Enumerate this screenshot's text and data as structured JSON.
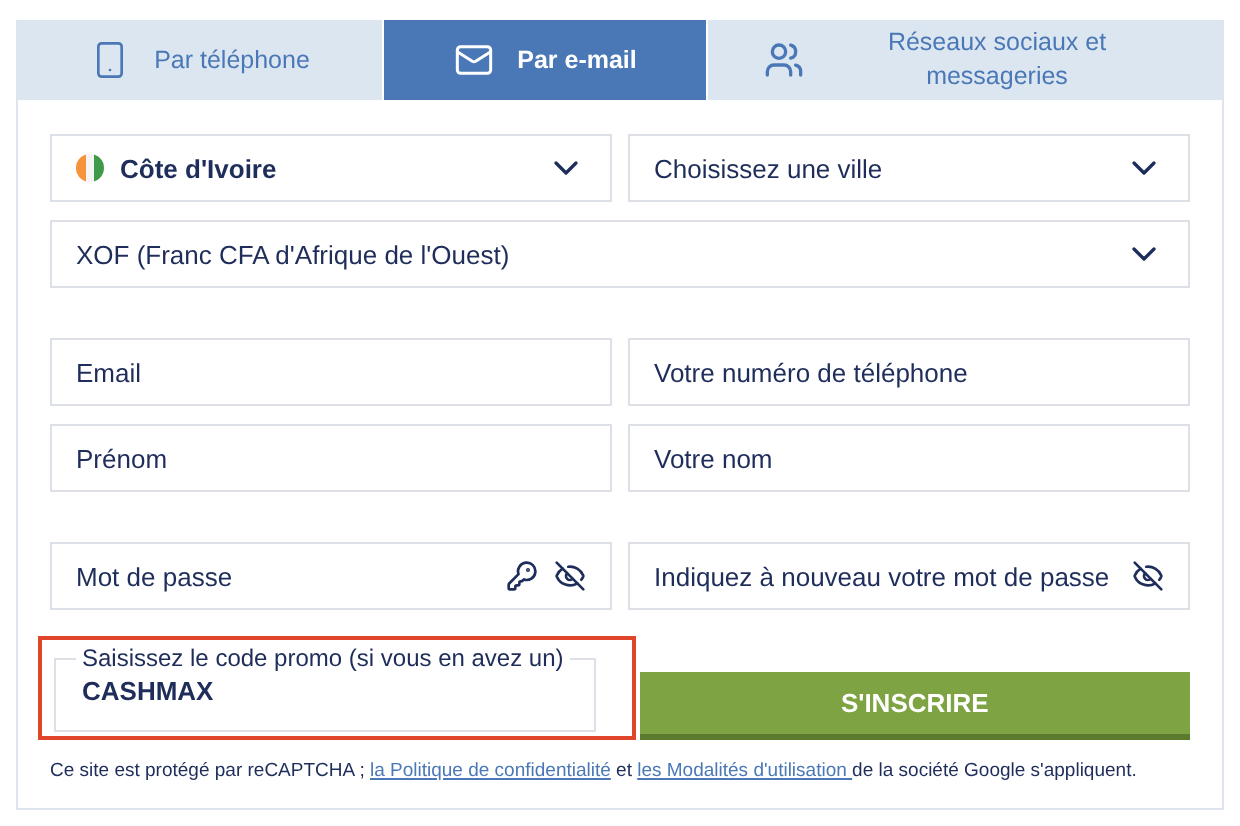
{
  "tabs": [
    {
      "label": "Par téléphone",
      "selected": false
    },
    {
      "label": "Par e-mail",
      "selected": true
    },
    {
      "label": "Réseaux sociaux et messageries",
      "selected": false
    }
  ],
  "rows": [
    [
      {
        "kind": "select",
        "value": "Côte d'Ivoire",
        "flag": true
      },
      {
        "kind": "select",
        "placeholder": "Choisissez une ville"
      }
    ],
    [
      {
        "kind": "select",
        "value": "XOF (Franc CFA d'Afrique de l'Ouest)"
      }
    ],
    [
      {
        "kind": "input",
        "placeholder": "Email"
      },
      {
        "kind": "input",
        "placeholder": "Votre numéro de téléphone"
      }
    ],
    [
      {
        "kind": "input",
        "placeholder": "Prénom"
      },
      {
        "kind": "input",
        "placeholder": "Votre nom"
      }
    ],
    [
      {
        "kind": "password",
        "placeholder": "Mot de passe",
        "key": true
      },
      {
        "kind": "password",
        "placeholder": "Indiquez à nouveau votre mot de passe",
        "key": false
      }
    ]
  ],
  "promo": {
    "label": "Saisissez le code promo (si vous en avez un)",
    "value": "CASHMAX",
    "highlighted": true
  },
  "submit": "S'INSCRIRE",
  "footer": [
    {
      "kind": "text",
      "text": "Ce site est protégé par reCAPTCHA ; "
    },
    {
      "kind": "link",
      "text": "la Politique de confidentialité"
    },
    {
      "kind": "text",
      "text": " et "
    },
    {
      "kind": "link",
      "text": "les Modalités d'utilisation "
    },
    {
      "kind": "text",
      "text": "de la société Google s'appliquent."
    }
  ]
}
